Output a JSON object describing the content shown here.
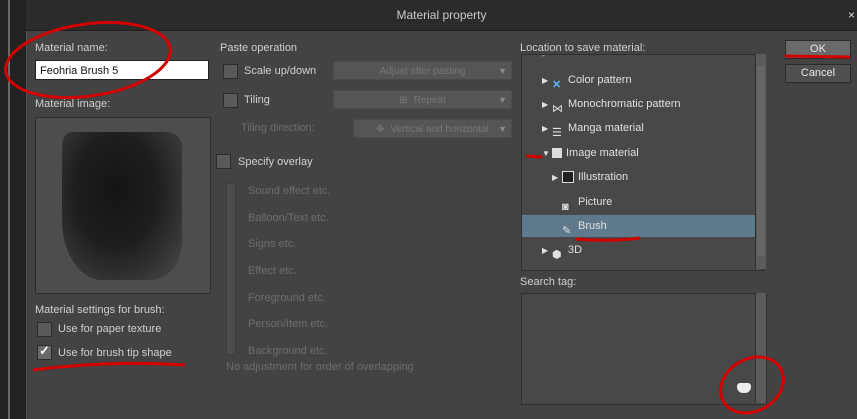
{
  "window": {
    "title": "Material property",
    "close_glyph": "×"
  },
  "left": {
    "material_name_label": "Material name:",
    "material_name_value": "Feohria Brush 5",
    "material_image_label": "Material image:",
    "settings_label": "Material settings for brush:",
    "paper_texture_label": "Use for paper texture",
    "paper_texture_checked": false,
    "brush_tip_label": "Use for brush tip shape",
    "brush_tip_checked": true,
    "check_glyph": "✓"
  },
  "middle": {
    "paste_label": "Paste operation",
    "scale_label": "Scale up/down",
    "scale_dropdown": "Adjust after pasting",
    "tiling_label": "Tiling",
    "tiling_dropdown": "Repeat",
    "tiling_direction_label": "Tiling direction:",
    "tiling_direction_dropdown": "Vertical and horizontal",
    "overlay_label": "Specify overlay",
    "overlay_items": [
      "Sound effect etc.",
      "Balloon/Text etc.",
      "Signs etc.",
      "Effect etc.",
      "Foreground etc.",
      "Person/Item etc.",
      "Background etc."
    ],
    "overlay_note": "No adjustment for order of overlapping"
  },
  "right": {
    "location_label": "Location to save material:",
    "tree_items": [
      {
        "label": "Color pattern",
        "icon": "color-pattern-icon"
      },
      {
        "label": "Monochromatic pattern",
        "icon": "monochromatic-pattern-icon"
      },
      {
        "label": "Manga material",
        "icon": "manga-material-icon"
      },
      {
        "label": "Image material",
        "icon": "image-material-icon"
      },
      {
        "label": "Illustration",
        "icon": "illustration-icon"
      },
      {
        "label": "Picture",
        "icon": "camera-icon"
      },
      {
        "label": "Brush",
        "icon": "brush-icon"
      },
      {
        "label": "3D",
        "icon": "3d-icon"
      }
    ],
    "search_tag_label": "Search tag:"
  },
  "buttons": {
    "ok": "OK",
    "cancel": "Cancel"
  },
  "colors": {
    "annotation_red": "#d40000",
    "selection": "#5f7a8c"
  }
}
